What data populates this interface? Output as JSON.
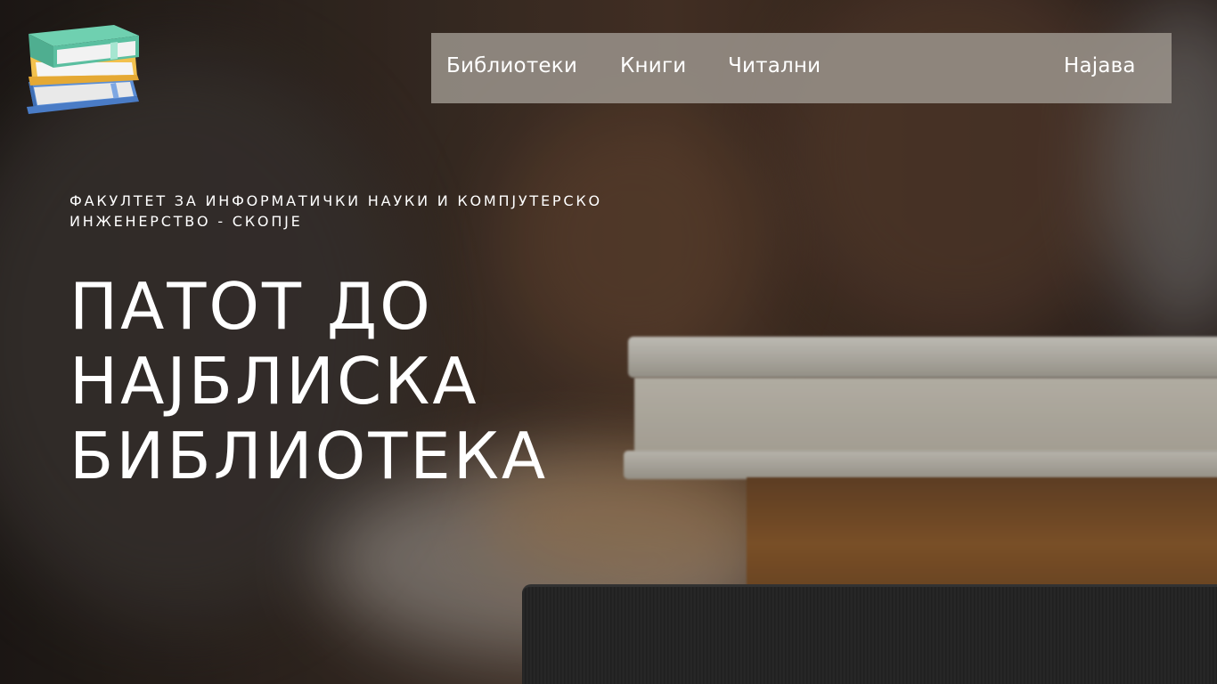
{
  "nav": {
    "items": [
      {
        "label": "Библиотеки"
      },
      {
        "label": "Книги"
      },
      {
        "label": "Читални"
      }
    ],
    "login_label": "Најава"
  },
  "hero": {
    "subtitle": "ФАКУЛТЕТ ЗА ИНФОРМАТИЧКИ НАУКИ И КОМПЈУТЕРСКО ИНЖЕНЕРСТВО - СКОПЈЕ",
    "headline_lines": [
      "ПАТОТ ДО",
      "НАЈБЛИСКА",
      "БИБЛИОТЕКА"
    ]
  },
  "logo": {
    "icon": "books-stack-icon"
  },
  "colors": {
    "nav_background": "#9b948c",
    "text": "#ffffff",
    "book_teal": "#5bbfa0",
    "book_yellow": "#f2c14e",
    "book_blue": "#5b8ed6"
  }
}
